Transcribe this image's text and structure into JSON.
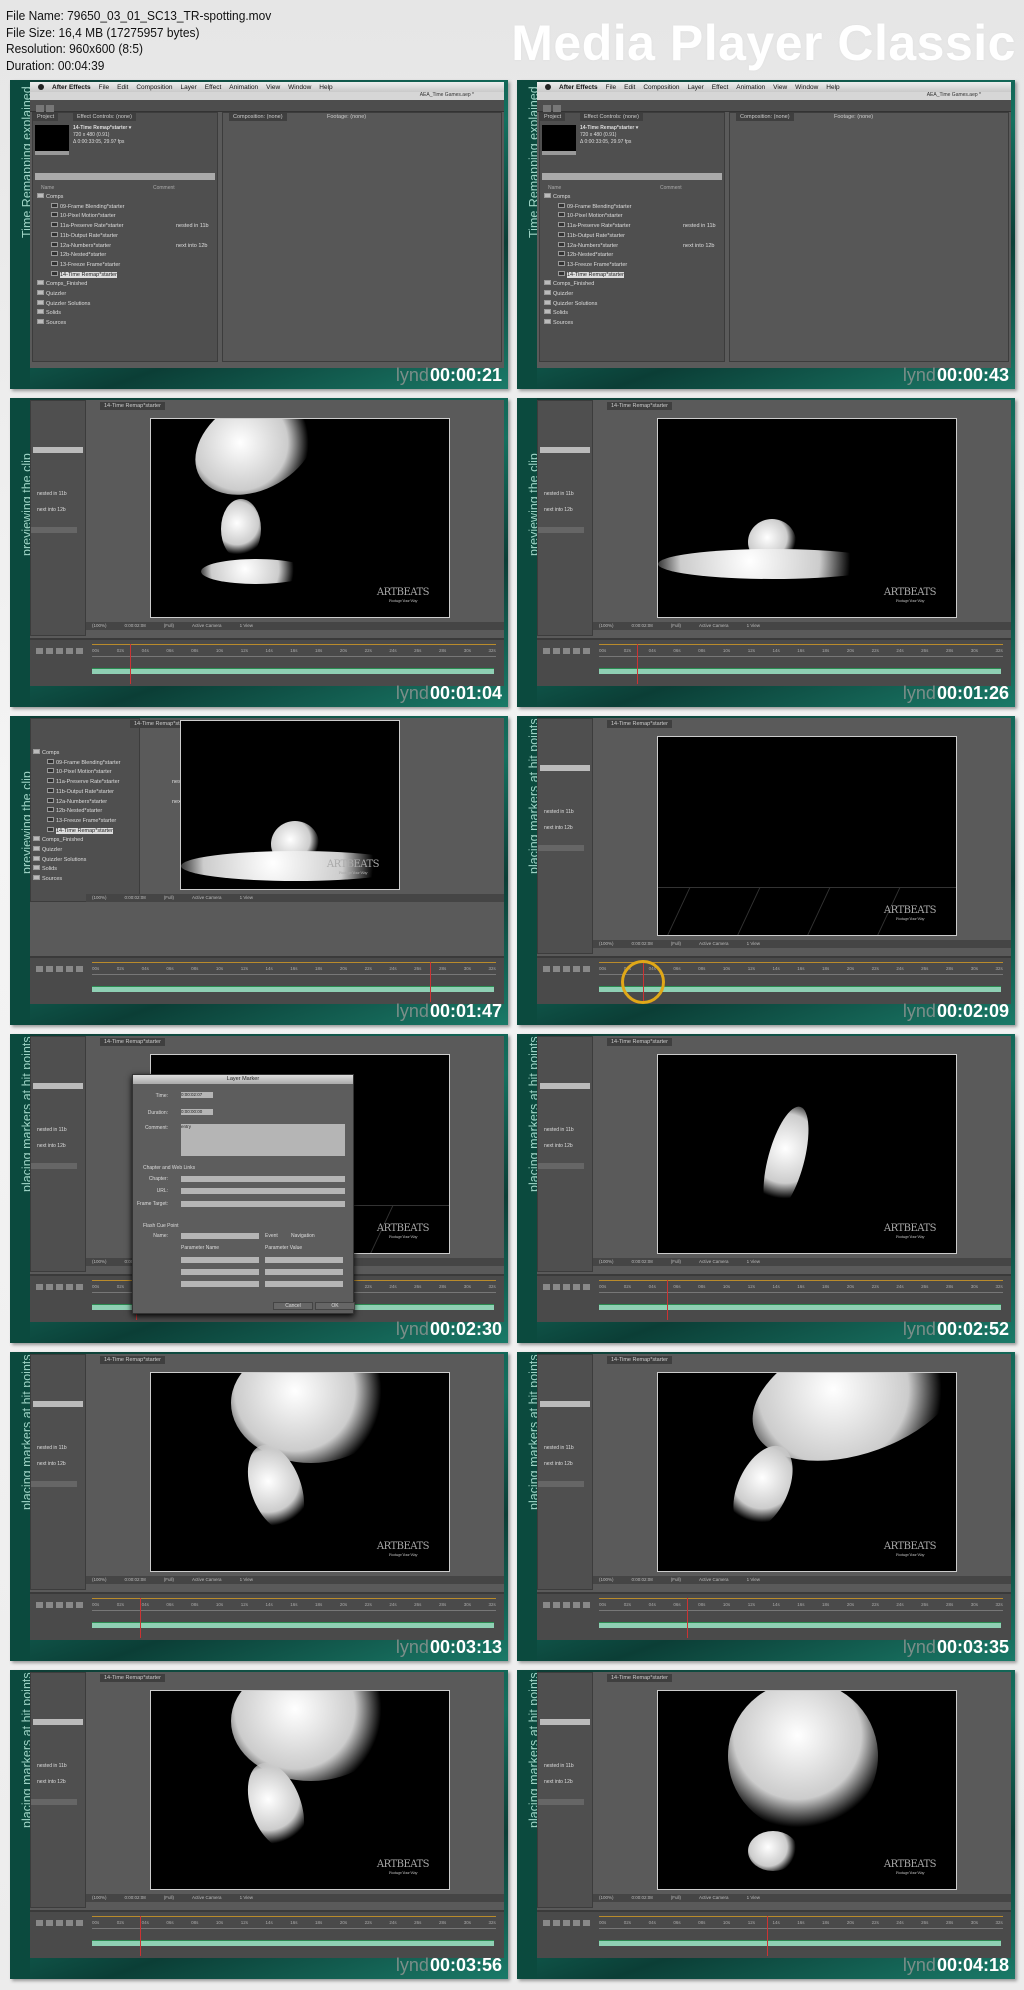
{
  "header": {
    "file_name": "File Name: 79650_03_01_SC13_TR-spotting.mov",
    "file_size": "File Size: 16,4 MB (17275957 bytes)",
    "resolution": "Resolution: 960x600 (8:5)",
    "duration": "Duration: 00:04:39",
    "brand": "Media Player Classic"
  },
  "watermark_prefix": "lynd",
  "ae": {
    "menu": [
      "After Effects",
      "File",
      "Edit",
      "Composition",
      "Layer",
      "Effect",
      "Animation",
      "View",
      "Window",
      "Help"
    ],
    "window_title": "AEA_Time Games.aep *",
    "project_tab": "Project",
    "effect_tab": "Effect Controls: (none)",
    "comp_tab": "Composition: (none)",
    "footage_tab": "Footage: (none)",
    "comp_name": "14-Time Remap*starter ▾",
    "comp_size": "720 x 480 (0.91)",
    "comp_duration": "Δ 0:00:33:05, 29.97 fps",
    "col_name": "Name",
    "col_comment": "Comment",
    "viewer_tab": "14-Time Remap*starter",
    "viewer_zoom": "(100%)",
    "viewer_time": "0:00:02:08",
    "viewer_res": "(Full)",
    "viewer_camera": "Active Camera",
    "viewer_view": "1 View",
    "comments": [
      "nested in 11b",
      "next into 12b"
    ],
    "ruler": [
      "00s",
      "02s",
      "04s",
      "06s",
      "08s",
      "10s",
      "12s",
      "14s",
      "16s",
      "18s",
      "20s",
      "22s",
      "24s",
      "26s",
      "28s",
      "30s",
      "32s"
    ],
    "items": [
      {
        "name": "Comps",
        "comment": "",
        "level": 0,
        "folder": true
      },
      {
        "name": "09-Frame Blending*starter",
        "comment": "",
        "level": 1
      },
      {
        "name": "10-Pixel Motion*starter",
        "comment": "",
        "level": 1
      },
      {
        "name": "11a-Preserve Rate*starter",
        "comment": "nested in 11b",
        "level": 1
      },
      {
        "name": "11b-Output Rate*starter",
        "comment": "",
        "level": 1
      },
      {
        "name": "12a-Numbers*starter",
        "comment": "next into 12b",
        "level": 1
      },
      {
        "name": "12b-Nested*starter",
        "comment": "",
        "level": 1
      },
      {
        "name": "13-Freeze Frame*starter",
        "comment": "",
        "level": 1
      },
      {
        "name": "14-Time Remap*starter",
        "comment": "",
        "level": 1,
        "selected": true
      },
      {
        "name": "Comps_Finished",
        "comment": "",
        "level": 0,
        "folder": true
      },
      {
        "name": "Quizzler",
        "comment": "",
        "level": 0,
        "folder": true
      },
      {
        "name": "Quizzler Solutions",
        "comment": "",
        "level": 0,
        "folder": true
      },
      {
        "name": "Solids",
        "comment": "",
        "level": 0,
        "folder": true
      },
      {
        "name": "Sources",
        "comment": "",
        "level": 0,
        "folder": true
      }
    ],
    "artbeats": "ARTBEATS",
    "artbeats_tag": "Footage Your Way"
  },
  "dialog": {
    "title": "Layer Marker",
    "time_label": "Time:",
    "time_value": "0:00:02:07",
    "duration_label": "Duration:",
    "duration_value": "0:00:00:00",
    "comment_label": "Comment:",
    "comment_value": "entry",
    "chapter_section": "Chapter and Web Links",
    "chapter_label": "Chapter:",
    "url_label": "URL:",
    "frame_label": "Frame Target:",
    "flash_section": "Flash Cue Point",
    "name_label": "Name:",
    "event_label": "Event",
    "navigation_label": "Navigation",
    "param_name": "Parameter Name",
    "param_value": "Parameter Value",
    "cancel": "Cancel",
    "ok": "OK"
  },
  "thumbnails": [
    {
      "time": "00:00:21",
      "label": "Time Remapping explained",
      "kind": "project"
    },
    {
      "time": "00:00:43",
      "label": "Time Remapping explained",
      "kind": "project"
    },
    {
      "time": "00:01:04",
      "label": "previewing the clip",
      "kind": "video"
    },
    {
      "time": "00:01:26",
      "label": "previewing the clip",
      "kind": "video"
    },
    {
      "time": "00:01:47",
      "label": "previewing the clip",
      "kind": "mixed"
    },
    {
      "time": "00:02:09",
      "label": "placing markers at hit points",
      "kind": "video"
    },
    {
      "time": "00:02:30",
      "label": "placing markers at hit points",
      "kind": "dialog"
    },
    {
      "time": "00:02:52",
      "label": "placing markers at hit points",
      "kind": "video"
    },
    {
      "time": "00:03:13",
      "label": "placing markers at hit points",
      "kind": "video"
    },
    {
      "time": "00:03:35",
      "label": "placing markers at hit points",
      "kind": "video"
    },
    {
      "time": "00:03:56",
      "label": "placing markers at hit points",
      "kind": "video"
    },
    {
      "time": "00:04:18",
      "label": "placing markers at hit points",
      "kind": "video"
    }
  ]
}
